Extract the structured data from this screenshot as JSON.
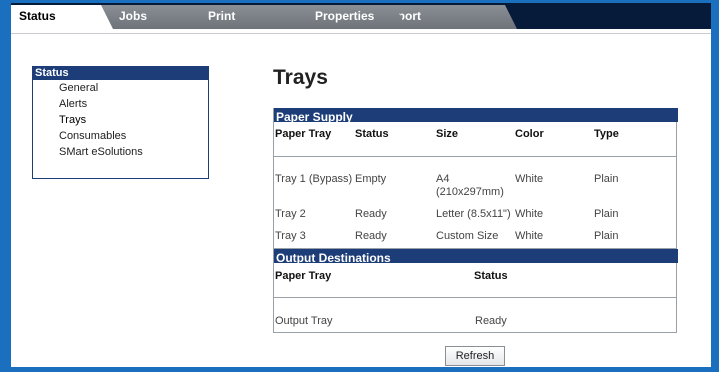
{
  "tabs": [
    {
      "label": "Status"
    },
    {
      "label": "Jobs"
    },
    {
      "label": "Print"
    },
    {
      "label": "Properties"
    },
    {
      "label": "Support"
    }
  ],
  "sidebar": {
    "heading": "Status",
    "items": [
      {
        "label": "General"
      },
      {
        "label": "Alerts"
      },
      {
        "label": "Trays"
      },
      {
        "label": "Consumables"
      },
      {
        "label": "SMart eSolutions"
      }
    ]
  },
  "page": {
    "title": "Trays"
  },
  "paper_supply": {
    "heading": "Paper Supply",
    "columns": [
      "Paper Tray",
      "Status",
      "Size",
      "Color",
      "Type"
    ],
    "rows": [
      {
        "tray": "Tray 1 (Bypass)",
        "status": "Empty",
        "size_line1": "A4",
        "size_line2": "(210x297mm)",
        "color": "White",
        "type": "Plain"
      },
      {
        "tray": "Tray 2",
        "status": "Ready",
        "size_line1": "Letter (8.5x11\")",
        "size_line2": "",
        "color": "White",
        "type": "Plain"
      },
      {
        "tray": "Tray 3",
        "status": "Ready",
        "size_line1": "Custom Size",
        "size_line2": "",
        "color": "White",
        "type": "Plain"
      }
    ]
  },
  "output_destinations": {
    "heading": "Output Destinations",
    "columns": [
      "Paper Tray",
      "Status"
    ],
    "rows": [
      {
        "tray": "Output Tray",
        "status": "Ready"
      }
    ]
  },
  "refresh_label": "Refresh",
  "colors": {
    "frame": "#1a6fbf",
    "header_navy": "#1c3d78",
    "tabbar": "#061a3a"
  }
}
